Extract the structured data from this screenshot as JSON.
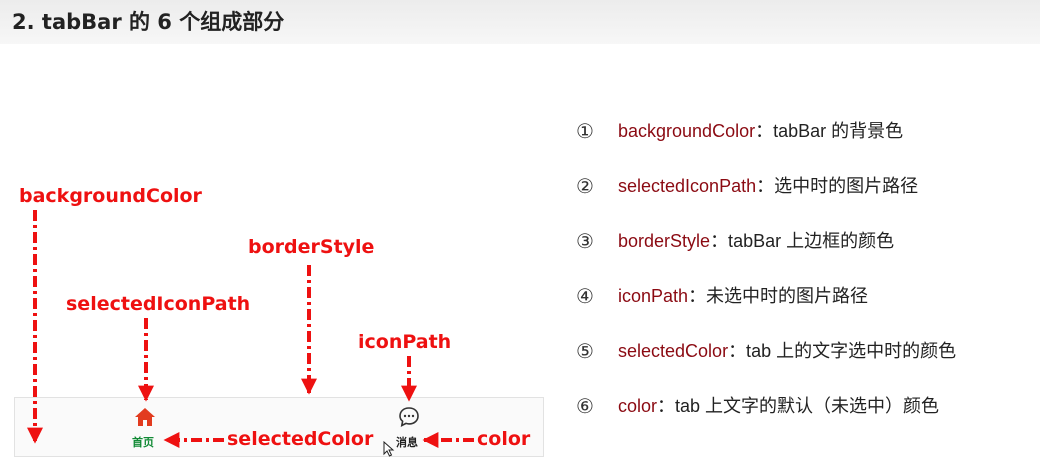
{
  "title": "2. tabBar 的 6 个组成部分",
  "colors": {
    "arrow": "#ee1111",
    "key": "#8b0a12",
    "selected_tab": "#118a35",
    "text": "#222222"
  },
  "tabbar": {
    "tabs": [
      {
        "label": "首页",
        "icon": "home-icon",
        "selected": true
      },
      {
        "label": "消息",
        "icon": "chat-bubble-icon",
        "selected": false
      }
    ]
  },
  "callouts": {
    "background_color": "backgroundColor",
    "border_style": "borderStyle",
    "selected_icon_path": "selectedIconPath",
    "icon_path": "iconPath",
    "selected_color": "selectedColor",
    "color": "color"
  },
  "legend": [
    {
      "num": "①",
      "key": "backgroundColor",
      "desc": "：tabBar 的背景色"
    },
    {
      "num": "②",
      "key": "selectedIconPath",
      "desc": "：选中时的图片路径"
    },
    {
      "num": "③",
      "key": "borderStyle",
      "desc": "：tabBar 上边框的颜色"
    },
    {
      "num": "④",
      "key": "iconPath",
      "desc": "：未选中时的图片路径"
    },
    {
      "num": "⑤",
      "key": "selectedColor",
      "desc": "：tab 上的文字选中时的颜色"
    },
    {
      "num": "⑥",
      "key": "color",
      "desc": "：tab 上文字的默认（未选中）颜色"
    }
  ]
}
